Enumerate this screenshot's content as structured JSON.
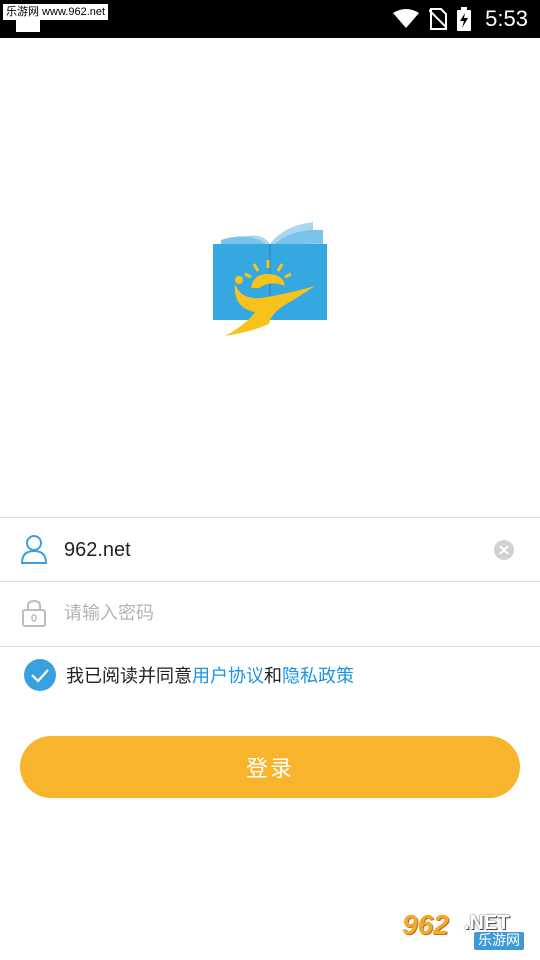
{
  "status_bar": {
    "watermark": "乐游网 www.962.net",
    "time": "5:53",
    "icons": [
      "wifi-icon",
      "no-sim-icon",
      "battery-charging-icon"
    ]
  },
  "login": {
    "username_value": "962.net",
    "password_placeholder": "请输入密码",
    "agreement_prefix": "我已阅读并同意",
    "user_agreement_link": "用户协议",
    "agreement_and": "和",
    "privacy_policy_link": "隐私政策",
    "agreement_checked": true,
    "submit_label": "登录"
  },
  "watermark_bottom": {
    "number": "962",
    "suffix": ".NET",
    "brand": "乐游网"
  },
  "colors": {
    "accent_blue": "#3aa0e0",
    "link_blue": "#1a95e0",
    "button_orange": "#f8b42d",
    "logo_blue": "#35a8e2",
    "logo_yellow": "#f7c21c"
  }
}
